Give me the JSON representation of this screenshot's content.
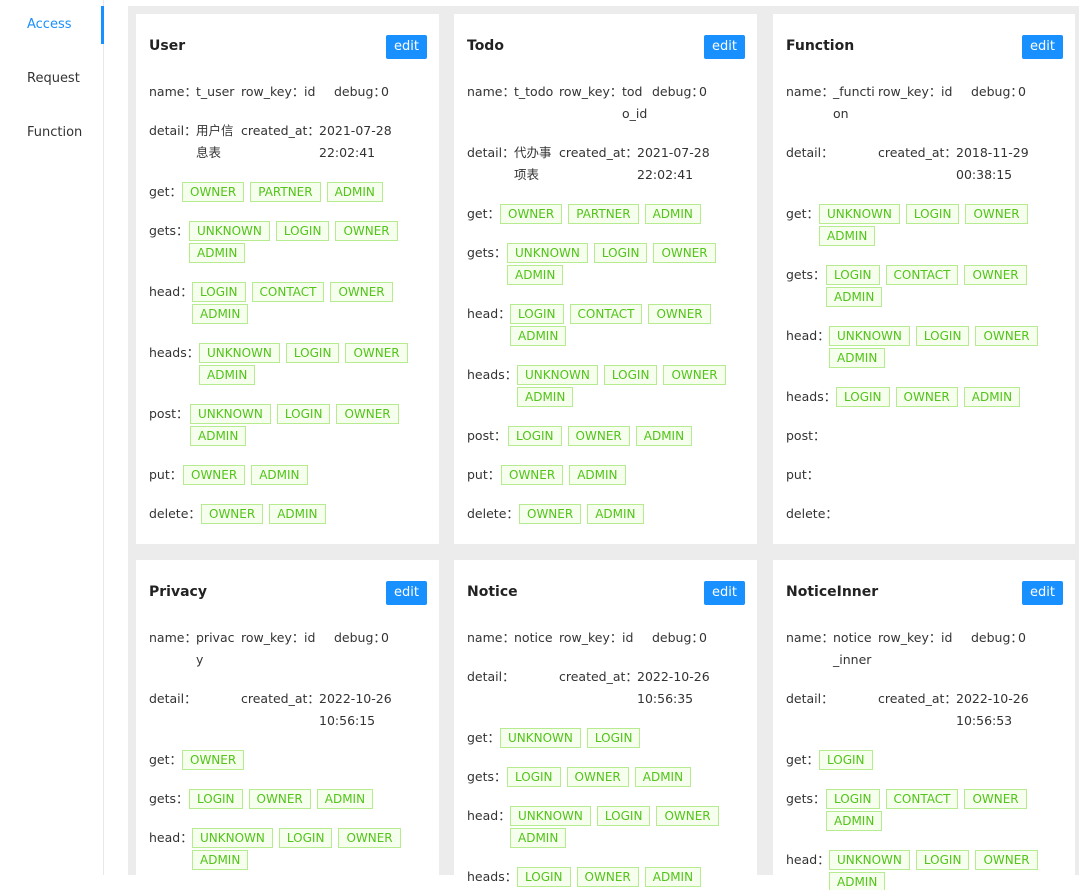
{
  "sidebar": {
    "items": [
      {
        "label": "Access",
        "active": true
      },
      {
        "label": "Request",
        "active": false
      },
      {
        "label": "Function",
        "active": false
      }
    ]
  },
  "labels": {
    "name": "name：",
    "row_key": "row_key：",
    "debug": "debug：",
    "detail": "detail：",
    "created_at": "created_at：",
    "edit": "edit",
    "get": "get：",
    "gets": "gets：",
    "head": "head：",
    "heads": "heads：",
    "post": "post：",
    "put": "put：",
    "delete": "delete："
  },
  "cards": [
    {
      "title": "User",
      "name": "t_user",
      "row_key": "id",
      "debug": "0",
      "detail": "用户信息表",
      "created_at": "2021-07-28 22:02:41",
      "get": [
        "OWNER",
        "PARTNER",
        "ADMIN"
      ],
      "gets": [
        "UNKNOWN",
        "LOGIN",
        "OWNER",
        "ADMIN"
      ],
      "head": [
        "LOGIN",
        "CONTACT",
        "OWNER",
        "ADMIN"
      ],
      "heads": [
        "UNKNOWN",
        "LOGIN",
        "OWNER",
        "ADMIN"
      ],
      "post": [
        "UNKNOWN",
        "LOGIN",
        "OWNER",
        "ADMIN"
      ],
      "put": [
        "OWNER",
        "ADMIN"
      ],
      "delete": [
        "OWNER",
        "ADMIN"
      ]
    },
    {
      "title": "Todo",
      "name": "t_todo",
      "row_key": "todo_id",
      "debug": "0",
      "detail": "代办事项表",
      "created_at": "2021-07-28 22:02:41",
      "get": [
        "OWNER",
        "PARTNER",
        "ADMIN"
      ],
      "gets": [
        "UNKNOWN",
        "LOGIN",
        "OWNER",
        "ADMIN"
      ],
      "head": [
        "LOGIN",
        "CONTACT",
        "OWNER",
        "ADMIN"
      ],
      "heads": [
        "UNKNOWN",
        "LOGIN",
        "OWNER",
        "ADMIN"
      ],
      "post": [
        "LOGIN",
        "OWNER",
        "ADMIN"
      ],
      "put": [
        "OWNER",
        "ADMIN"
      ],
      "delete": [
        "OWNER",
        "ADMIN"
      ]
    },
    {
      "title": "Function",
      "name": "_function",
      "row_key": "id",
      "debug": "0",
      "detail": "",
      "created_at": "2018-11-29 00:38:15",
      "get": [
        "UNKNOWN",
        "LOGIN",
        "OWNER",
        "ADMIN"
      ],
      "gets": [
        "LOGIN",
        "CONTACT",
        "OWNER",
        "ADMIN"
      ],
      "head": [
        "UNKNOWN",
        "LOGIN",
        "OWNER",
        "ADMIN"
      ],
      "heads": [
        "LOGIN",
        "OWNER",
        "ADMIN"
      ],
      "post": [],
      "put": [],
      "delete": []
    },
    {
      "title": "Privacy",
      "name": "privacy",
      "row_key": "id",
      "debug": "0",
      "detail": "",
      "created_at": "2022-10-26 10:56:15",
      "get": [
        "OWNER"
      ],
      "gets": [
        "LOGIN",
        "OWNER",
        "ADMIN"
      ],
      "head": [
        "UNKNOWN",
        "LOGIN",
        "OWNER",
        "ADMIN"
      ]
    },
    {
      "title": "Notice",
      "name": "notice",
      "row_key": "id",
      "debug": "0",
      "detail": "",
      "created_at": "2022-10-26 10:56:35",
      "get": [
        "UNKNOWN",
        "LOGIN"
      ],
      "gets": [
        "LOGIN",
        "OWNER",
        "ADMIN"
      ],
      "head": [
        "UNKNOWN",
        "LOGIN",
        "OWNER",
        "ADMIN"
      ],
      "heads": [
        "LOGIN",
        "OWNER",
        "ADMIN"
      ]
    },
    {
      "title": "NoticeInner",
      "name": "notice_inner",
      "row_key": "id",
      "debug": "0",
      "detail": "",
      "created_at": "2022-10-26 10:56:53",
      "get": [
        "LOGIN"
      ],
      "gets": [
        "LOGIN",
        "CONTACT",
        "OWNER",
        "ADMIN"
      ],
      "head": [
        "UNKNOWN",
        "LOGIN",
        "OWNER",
        "ADMIN"
      ]
    }
  ]
}
